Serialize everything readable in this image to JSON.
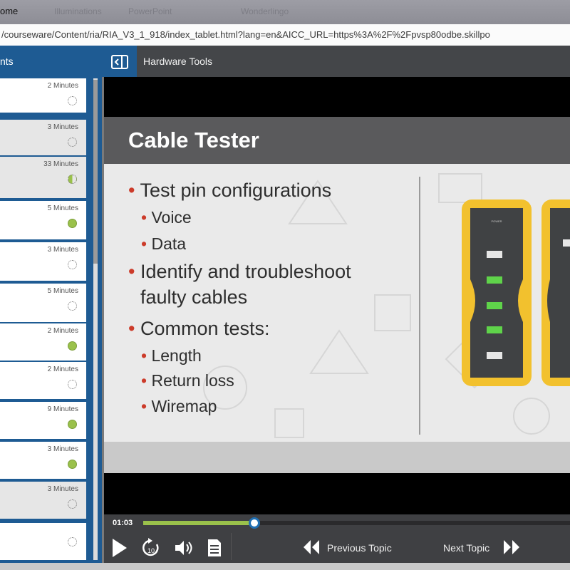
{
  "window": {
    "title": "ome",
    "faded_tabs": [
      "Illuminations",
      "PowerPoint",
      "Wonderlingo"
    ]
  },
  "browser": {
    "url": "/courseware/Content/ria/RIA_V3_1_918/index_tablet.html?lang=en&AICC_URL=https%3A%2F%2Fpvsp80odbe.skillpo"
  },
  "sidebar": {
    "title": "nts",
    "collapse_icon": "panel-collapse-icon",
    "items": [
      {
        "duration": "2 Minutes",
        "status": "empty"
      },
      {
        "duration": "3 Minutes",
        "status": "empty"
      },
      {
        "duration": "33 Minutes",
        "status": "half"
      },
      {
        "duration": "5 Minutes",
        "status": "done"
      },
      {
        "duration": "3 Minutes",
        "status": "empty"
      },
      {
        "duration": "5 Minutes",
        "status": "empty"
      },
      {
        "duration": "2 Minutes",
        "status": "done"
      },
      {
        "duration": "2 Minutes",
        "status": "empty"
      },
      {
        "duration": "9 Minutes",
        "status": "done"
      },
      {
        "duration": "3 Minutes",
        "status": "done"
      },
      {
        "duration": "3 Minutes",
        "status": "empty"
      },
      {
        "duration": "",
        "status": "empty"
      }
    ]
  },
  "topbar": {
    "title": "Hardware Tools"
  },
  "slide": {
    "title": "Cable Tester",
    "bullets": [
      {
        "level": 1,
        "text": "Test pin configurations"
      },
      {
        "level": 2,
        "text": "Voice"
      },
      {
        "level": 2,
        "text": "Data"
      },
      {
        "level": 1,
        "text": "Identify and troubleshoot"
      },
      {
        "level": 0,
        "text": "faulty cables"
      },
      {
        "level": 1,
        "text": "Common tests:"
      },
      {
        "level": 2,
        "text": "Length"
      },
      {
        "level": 2,
        "text": "Return loss"
      },
      {
        "level": 2,
        "text": "Wiremap"
      }
    ],
    "colors": {
      "header": "#5a5a5c",
      "bullet": "#cc3b2a",
      "device_frame": "#f2c12e"
    }
  },
  "player": {
    "time": "01:03",
    "progress": 0.26,
    "previous_label": "Previous Topic",
    "next_label": "Next Topic",
    "icons": [
      "play-icon",
      "replay-10-icon",
      "volume-icon",
      "transcript-icon"
    ]
  }
}
